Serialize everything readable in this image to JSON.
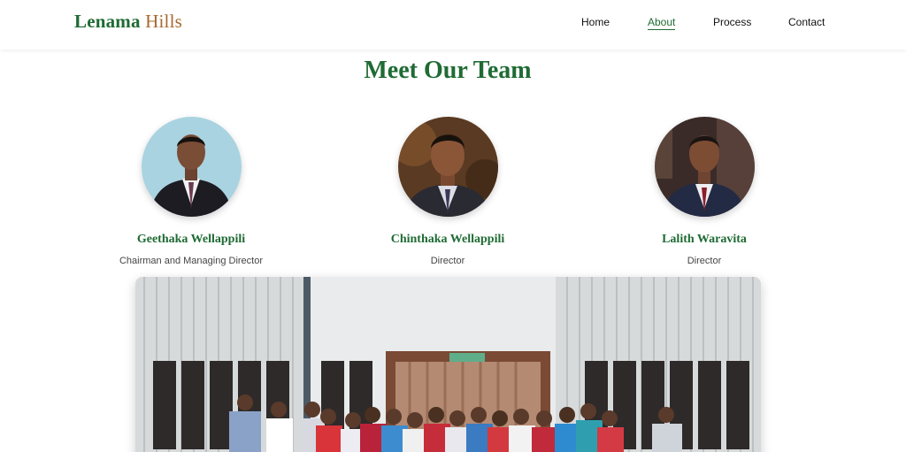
{
  "brand": {
    "part1": "Lenama",
    "part2": "Hills"
  },
  "nav": {
    "items": [
      {
        "label": "Home",
        "active": false
      },
      {
        "label": "About",
        "active": true
      },
      {
        "label": "Process",
        "active": false
      },
      {
        "label": "Contact",
        "active": false
      }
    ]
  },
  "team": {
    "title": "Meet Our Team",
    "members": [
      {
        "name": "Geethaka Wellappili",
        "role": "Chairman and Managing Director"
      },
      {
        "name": "Chinthaka Wellappili",
        "role": "Director"
      },
      {
        "name": "Lalith Waravita",
        "role": "Director"
      }
    ]
  },
  "colors": {
    "brand_green": "#1f6b34",
    "brand_brown": "#a7692e"
  },
  "icons": {
    "group_photo": "team-group-photo"
  }
}
